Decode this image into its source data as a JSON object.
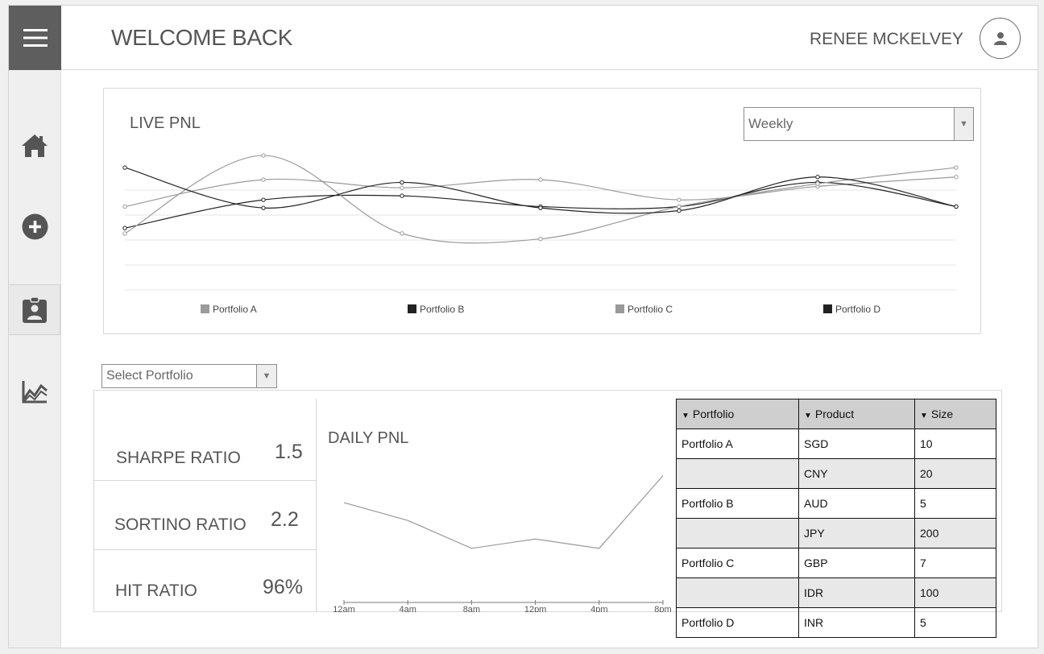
{
  "header": {
    "title": "WELCOME BACK",
    "user_name": "RENEE MCKELVEY"
  },
  "sidebar": {
    "menu_icon": "hamburger-icon",
    "items": [
      {
        "icon": "home-icon"
      },
      {
        "icon": "add-circle-icon"
      },
      {
        "icon": "clipboard-user-icon",
        "active": true
      },
      {
        "icon": "line-chart-icon"
      }
    ]
  },
  "live_pnl": {
    "title": "LIVE PNL",
    "period": "Weekly",
    "legend": [
      "Portfolio A",
      "Portfolio B",
      "Portfolio C",
      "Portfolio D"
    ],
    "chart_data": {
      "type": "line",
      "x": [
        0,
        1,
        2,
        3,
        4,
        5,
        6
      ],
      "series": [
        {
          "name": "Portfolio A",
          "color": "#9a9a9a",
          "values": [
            62,
            82,
            76,
            82,
            67,
            77,
            84
          ]
        },
        {
          "name": "Portfolio B",
          "color": "#222222",
          "values": [
            46,
            67,
            70,
            62,
            62,
            80,
            62
          ]
        },
        {
          "name": "Portfolio C",
          "color": "#9a9a9a",
          "values": [
            42,
            100,
            42,
            38,
            62,
            79,
            91
          ]
        },
        {
          "name": "Portfolio D",
          "color": "#222222",
          "values": [
            91,
            61,
            80,
            61,
            59,
            84,
            62
          ]
        }
      ],
      "ylim": [
        0,
        115
      ]
    }
  },
  "portfolio_select": {
    "placeholder": "Select Portfolio"
  },
  "metrics": [
    {
      "label": "SHARPE RATIO",
      "value": "1.5"
    },
    {
      "label": "SORTINO RATIO",
      "value": "2.2"
    },
    {
      "label": "HIT RATIO",
      "value": "96%"
    }
  ],
  "daily_pnl": {
    "title": "DAILY PNL",
    "chart_data": {
      "type": "line",
      "categories": [
        "12am",
        "4am",
        "8am",
        "12pm",
        "4pm",
        "8pm"
      ],
      "values": [
        118,
        97,
        64,
        75,
        64,
        150
      ],
      "ylim": [
        0,
        160
      ]
    }
  },
  "table": {
    "headers": [
      "Portfolio",
      "Product",
      "Size"
    ],
    "rows": [
      [
        "Portfolio A",
        "SGD",
        "10"
      ],
      [
        "",
        "CNY",
        "20"
      ],
      [
        "Portfolio B",
        "AUD",
        "5"
      ],
      [
        "",
        "JPY",
        "200"
      ],
      [
        "Portfolio C",
        "GBP",
        "7"
      ],
      [
        "",
        "IDR",
        "100"
      ],
      [
        "Portfolio D",
        "INR",
        "5"
      ]
    ]
  }
}
